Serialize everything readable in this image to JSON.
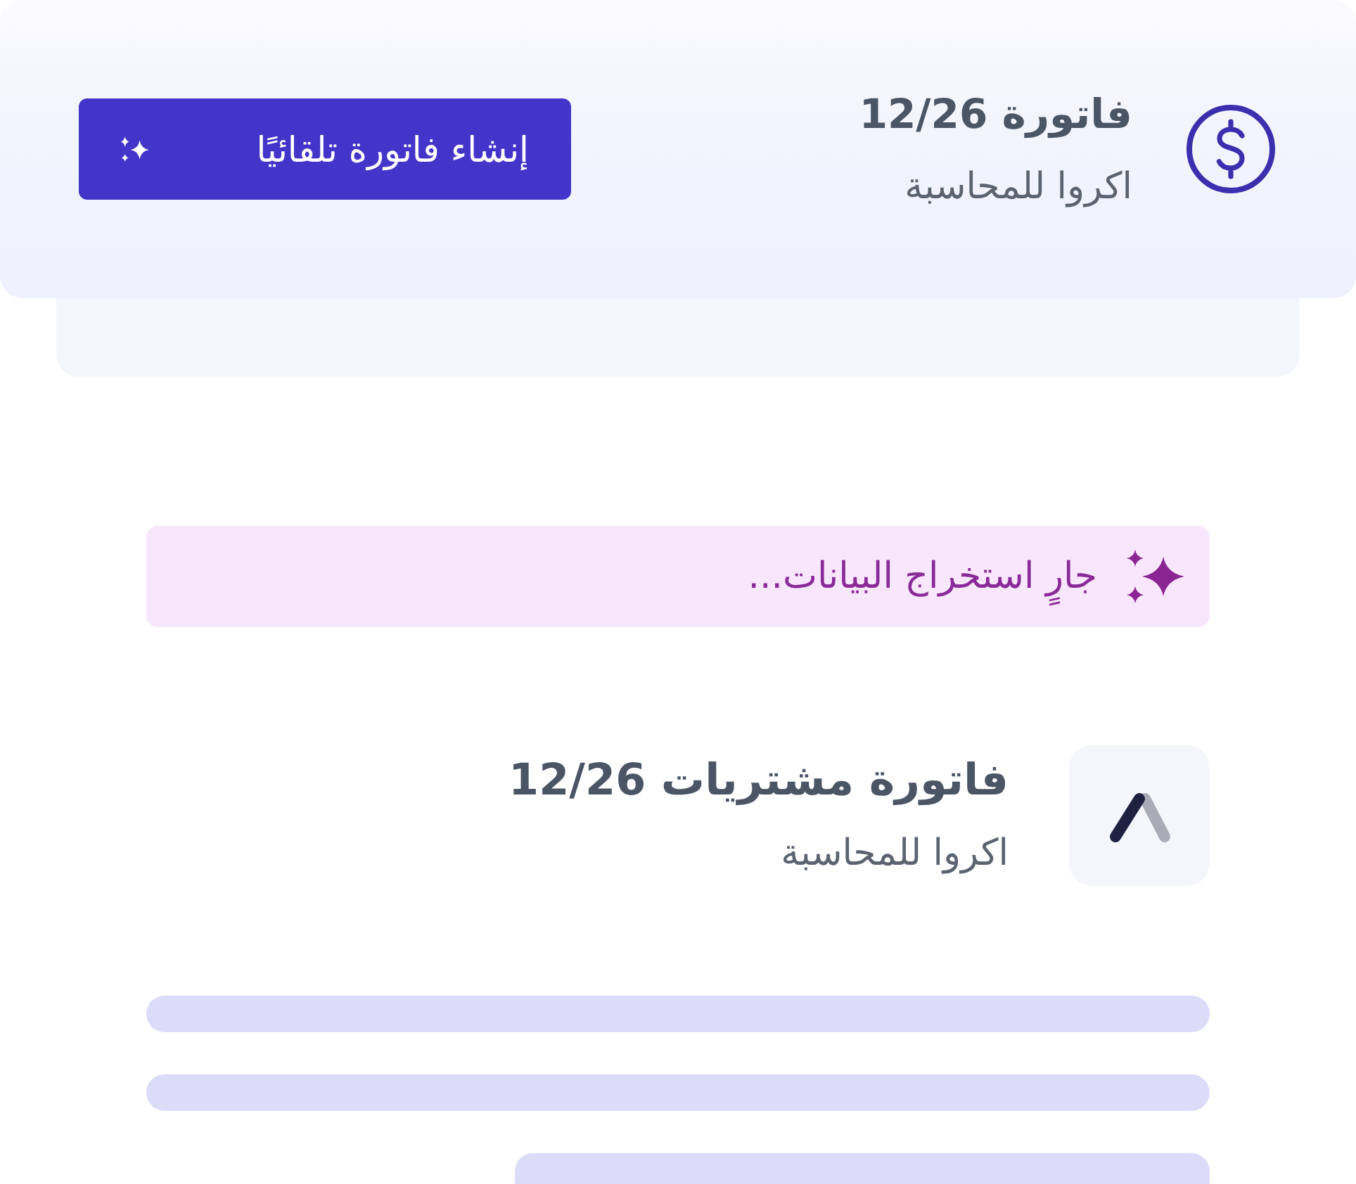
{
  "header_card": {
    "title": "فاتورة 12/26",
    "subtitle": "اكروا للمحاسبة",
    "button": {
      "label": "إنشاء فاتورة تلقائيًا"
    }
  },
  "status_banner": {
    "text": "جارٍ استخراج البيانات..."
  },
  "invoice": {
    "title": "فاتورة مشتريات 12/26",
    "subtitle": "اكروا للمحاسبة"
  }
}
